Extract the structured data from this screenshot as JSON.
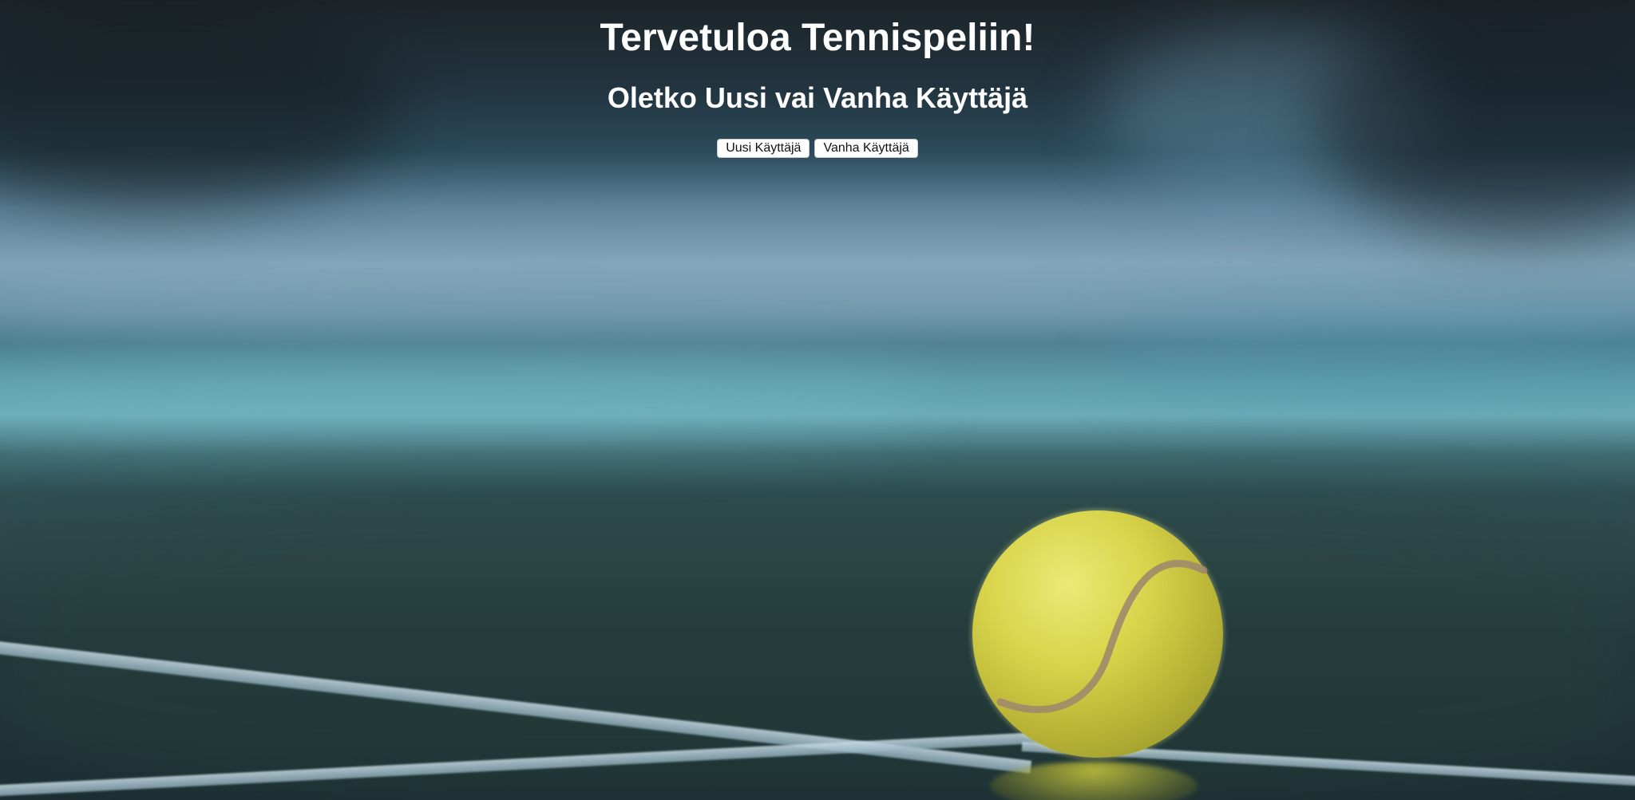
{
  "page": {
    "title": "Tervetuloa Tennispeliin!",
    "subtitle": "Oletko Uusi vai Vanha Käyttäjä"
  },
  "buttons": {
    "new_user_label": "Uusi Käyttäjä",
    "existing_user_label": "Vanha Käyttäjä"
  },
  "background": {
    "image_subject": "tennis ball on court",
    "ball_color": "#d8d44a",
    "court_line_color": "#c8dce6"
  }
}
